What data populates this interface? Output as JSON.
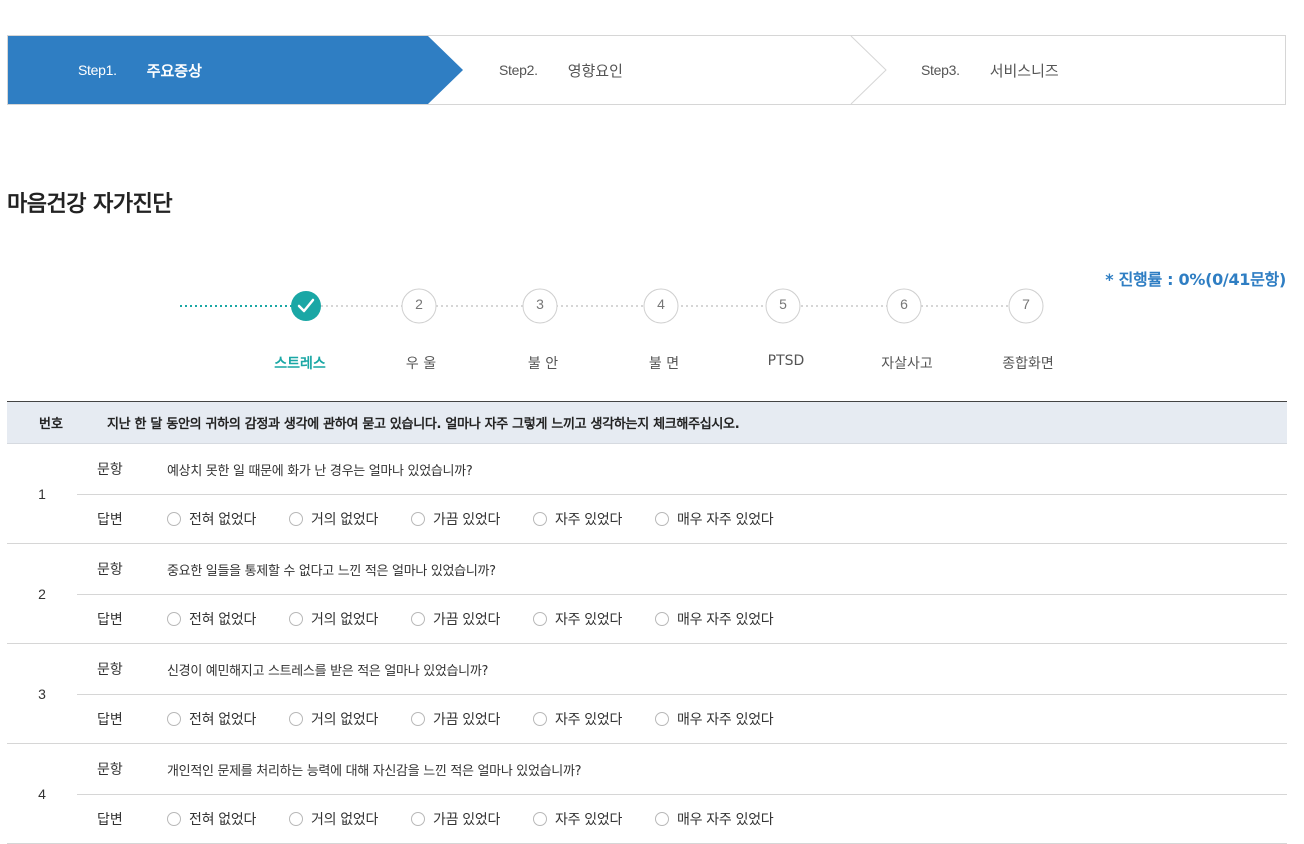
{
  "steps": [
    {
      "num": "Step1.",
      "label": "주요증상"
    },
    {
      "num": "Step2.",
      "label": "영향요인"
    },
    {
      "num": "Step3.",
      "label": "서비스니즈"
    }
  ],
  "colors": {
    "active_step": "#2f7ec3",
    "accent_teal": "#1aa7a5",
    "header_bg": "#e6ebf2"
  },
  "page_title": "마음건강 자가진단",
  "progress": "* 진행률 : 0%(0/41문항)",
  "stages": [
    {
      "num": "",
      "label": "스트레스",
      "done": true,
      "icon": "check-icon"
    },
    {
      "num": "2",
      "label": "우 울"
    },
    {
      "num": "3",
      "label": "불 안"
    },
    {
      "num": "4",
      "label": "불 면"
    },
    {
      "num": "5",
      "label": "PTSD"
    },
    {
      "num": "6",
      "label": "자살사고"
    },
    {
      "num": "7",
      "label": "종합화면"
    }
  ],
  "table": {
    "header_no": "번호",
    "header_text": "지난 한 달 동안의 귀하의 감정과 생각에 관하여 묻고 있습니다. 얼마나 자주 그렇게 느끼고 생각하는지 체크해주십시오.",
    "question_tag": "문항",
    "answer_tag": "답변",
    "options": [
      "전혀 없었다",
      "거의 없었다",
      "가끔 있었다",
      "자주 있었다",
      "매우 자주 있었다"
    ],
    "rows": [
      {
        "no": "1",
        "question": "예상치 못한 일 때문에 화가 난 경우는 얼마나 있었습니까?"
      },
      {
        "no": "2",
        "question": "중요한 일들을 통제할 수 없다고 느낀 적은 얼마나 있었습니까?"
      },
      {
        "no": "3",
        "question": "신경이 예민해지고 스트레스를 받은 적은 얼마나 있었습니까?"
      },
      {
        "no": "4",
        "question": "개인적인 문제를 처리하는 능력에 대해 자신감을 느낀 적은 얼마나 있었습니까?"
      }
    ]
  }
}
